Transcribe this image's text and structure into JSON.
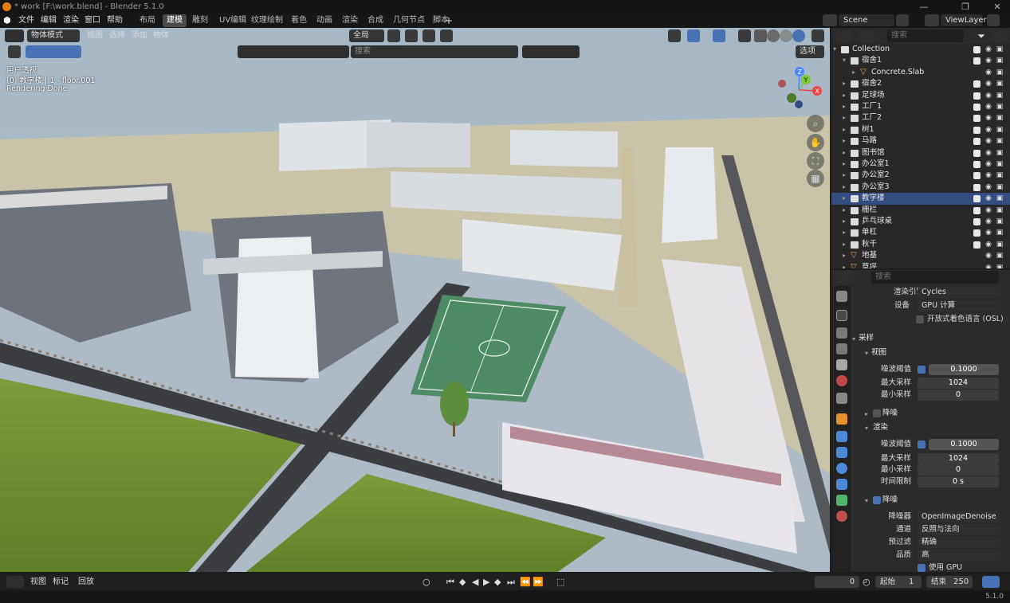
{
  "window": {
    "title": "* work [F:\\work.blend] - Blender 5.1.0",
    "minimize": "—",
    "maximize": "❐",
    "close": "✕"
  },
  "menu": [
    "文件",
    "编辑",
    "渲染",
    "窗口",
    "帮助"
  ],
  "workspaces": [
    {
      "label": "布局",
      "active": false
    },
    {
      "label": "建模",
      "active": true
    },
    {
      "label": "雕刻",
      "active": false
    },
    {
      "label": "UV编辑",
      "active": false
    },
    {
      "label": "纹理绘制",
      "active": false
    },
    {
      "label": "着色",
      "active": false
    },
    {
      "label": "动画",
      "active": false
    },
    {
      "label": "渲染",
      "active": false
    },
    {
      "label": "合成",
      "active": false
    },
    {
      "label": "几何节点",
      "active": false
    },
    {
      "label": "脚本",
      "active": false
    }
  ],
  "workspace_add": "+",
  "scene": {
    "name": "Scene",
    "view_layer": "ViewLayer"
  },
  "viewport": {
    "mode": "物体模式",
    "menus": [
      "视图",
      "选择",
      "添加",
      "物体"
    ],
    "transform_orientation": "全局",
    "search_placeholder": "搜索",
    "options_label": "选项",
    "overlay_line1": "用户透视",
    "overlay_line2": "(0) 教学楼 | 1 - floor.001",
    "overlay_line3": "Rendering Done",
    "gizmo_axes": [
      "X",
      "Y",
      "Z"
    ]
  },
  "outliner": {
    "search_placeholder": "搜索",
    "items": [
      {
        "name": "Collection",
        "level": 0,
        "type": "collection",
        "expanded": true,
        "selected": false
      },
      {
        "name": "宿舍1",
        "level": 1,
        "type": "collection",
        "expanded": true,
        "selected": false
      },
      {
        "name": "Concrete.Slab",
        "level": 2,
        "type": "mesh",
        "expanded": false,
        "selected": false
      },
      {
        "name": "宿舍2",
        "level": 1,
        "type": "collection",
        "expanded": false,
        "selected": false
      },
      {
        "name": "足球场",
        "level": 1,
        "type": "collection",
        "expanded": false,
        "selected": false
      },
      {
        "name": "工厂1",
        "level": 1,
        "type": "collection",
        "expanded": false,
        "selected": false
      },
      {
        "name": "工厂2",
        "level": 1,
        "type": "collection",
        "expanded": false,
        "selected": false
      },
      {
        "name": "树1",
        "level": 1,
        "type": "collection",
        "expanded": false,
        "selected": false
      },
      {
        "name": "马路",
        "level": 1,
        "type": "collection",
        "expanded": false,
        "selected": false
      },
      {
        "name": "图书馆",
        "level": 1,
        "type": "collection",
        "expanded": false,
        "selected": false
      },
      {
        "name": "办公室1",
        "level": 1,
        "type": "collection",
        "expanded": false,
        "selected": false
      },
      {
        "name": "办公室2",
        "level": 1,
        "type": "collection",
        "expanded": false,
        "selected": false
      },
      {
        "name": "办公室3",
        "level": 1,
        "type": "collection",
        "expanded": false,
        "selected": false
      },
      {
        "name": "教学楼",
        "level": 1,
        "type": "collection",
        "expanded": false,
        "selected": true
      },
      {
        "name": "栅栏",
        "level": 1,
        "type": "collection",
        "expanded": false,
        "selected": false
      },
      {
        "name": "乒乓球桌",
        "level": 1,
        "type": "collection",
        "expanded": false,
        "selected": false
      },
      {
        "name": "单杠",
        "level": 1,
        "type": "collection",
        "expanded": false,
        "selected": false
      },
      {
        "name": "秋千",
        "level": 1,
        "type": "collection",
        "expanded": false,
        "selected": false
      },
      {
        "name": "地基",
        "level": 1,
        "type": "mesh",
        "expanded": false,
        "selected": false
      },
      {
        "name": "草坪",
        "level": 1,
        "type": "mesh",
        "expanded": false,
        "selected": false
      }
    ]
  },
  "properties": {
    "search_placeholder": "搜索",
    "render_engine_label": "渲染引擎",
    "render_engine": "Cycles",
    "device_label": "设备",
    "device": "GPU 计算",
    "osl_label": "开放式着色语言 (OSL)",
    "sampling": "采样",
    "viewport_section": "视图",
    "noise_threshold_label": "噪波阈值",
    "viewport_noise_threshold": "0.1000",
    "max_samples_label": "最大采样",
    "viewport_max_samples": "1024",
    "min_samples_label": "最小采样",
    "viewport_min_samples": "0",
    "viewport_denoise": "降噪",
    "render_section": "渲染",
    "render_noise_threshold": "0.1000",
    "render_max_samples": "1024",
    "render_min_samples": "0",
    "time_limit_label": "时间限制",
    "time_limit": "0 s",
    "denoise_section": "降噪",
    "denoiser_label": "降噪器",
    "denoiser": "OpenImageDenoise",
    "passes_label": "通道",
    "passes": "反照与法向",
    "prefilter_label": "预过滤",
    "prefilter": "精确",
    "quality_label": "品质",
    "quality": "高",
    "use_gpu_label": "使用 GPU"
  },
  "timeline": {
    "menus": [
      "视图",
      "标记"
    ],
    "playback": "回放",
    "current_frame": "0",
    "start_label": "起始",
    "start": "1",
    "end_label": "结束",
    "end": "250"
  },
  "status": {
    "version": "5.1.0"
  },
  "colors": {
    "accent": "#4772b3",
    "selection": "#334d80",
    "orange": "#e87d0d"
  }
}
